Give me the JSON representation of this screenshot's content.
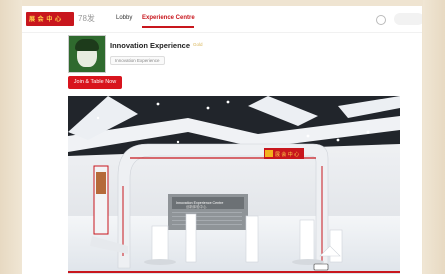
{
  "nav": {
    "logo_text": "展 会 中 心",
    "logo_sub": "78发",
    "lobby": "Lobby",
    "experience": "Experience Centre"
  },
  "booth": {
    "title": "Innovation Experience",
    "badge": "Gold",
    "tag": "Innovation Experience",
    "talk_button": "Join & Table Now"
  },
  "scene": {
    "sign_text": "展 会 中 心",
    "screen_text": "Innovation Experience Centre",
    "screen_sub": "创新体验中心"
  },
  "colors": {
    "accent": "#c8161d",
    "logo_yellow": "#f3b21d"
  }
}
